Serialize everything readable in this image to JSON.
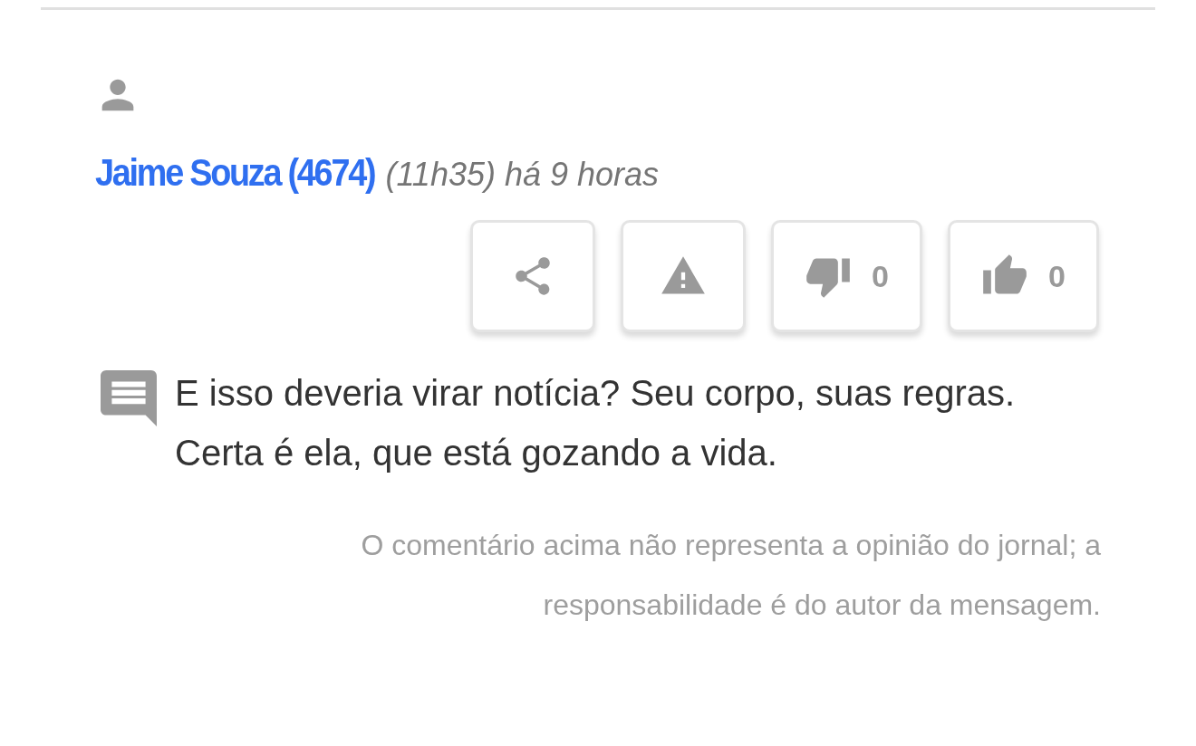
{
  "comment": {
    "author": "Jaime Souza (4674)",
    "time": "(11h35) há 9 horas",
    "actions": [
      {
        "kind": "share"
      },
      {
        "kind": "report"
      },
      {
        "kind": "dislike",
        "count": "0"
      },
      {
        "kind": "like",
        "count": "0"
      }
    ],
    "text": "E isso deveria virar notícia? Seu corpo, suas regras. Certa é ela, que está gozando a vida.",
    "disclaimer": "O comentário acima não representa a opinião do jornal; a responsabilidade é do autor da mensagem."
  }
}
